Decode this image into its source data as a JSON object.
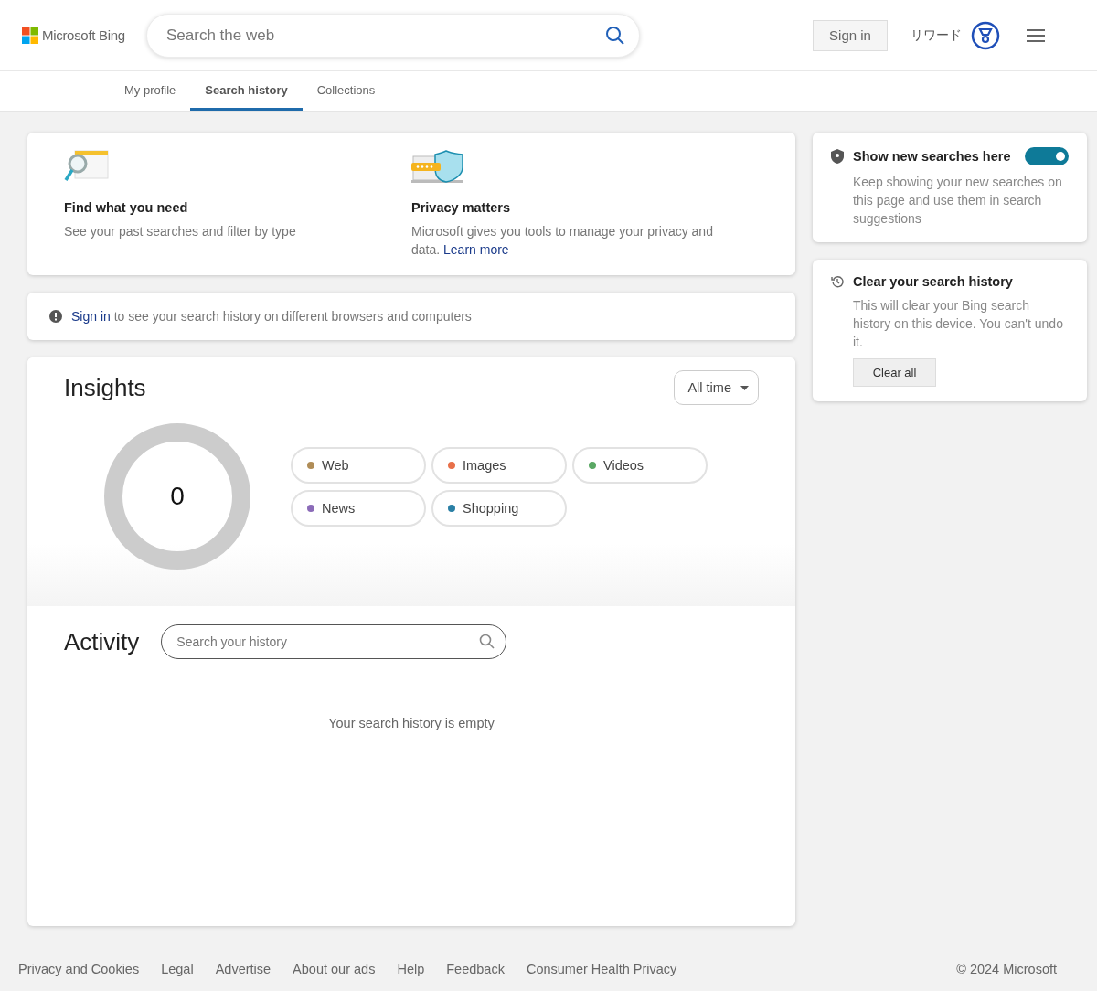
{
  "header": {
    "logo_text": "Microsoft Bing",
    "search": {
      "placeholder": "Search the web"
    },
    "sign_in": "Sign in",
    "rewards": "リワード"
  },
  "tabs": [
    {
      "label": "My profile",
      "selected": false
    },
    {
      "label": "Search history",
      "selected": true
    },
    {
      "label": "Collections",
      "selected": false
    }
  ],
  "features": [
    {
      "kind": "search",
      "title": "Find what you need",
      "text": "See your past searches and filter by type"
    },
    {
      "kind": "privacy",
      "title": "Privacy matters",
      "text": "Microsoft gives you tools to manage your privacy and data.",
      "link": "Learn more"
    }
  ],
  "notice": {
    "link": "Sign in",
    "text": "to see your search history on different browsers and computers"
  },
  "insights": {
    "title": "Insights",
    "period": "All time",
    "total": "0",
    "categories": [
      {
        "label": "Web",
        "color": "#b08d57"
      },
      {
        "label": "Images",
        "color": "#e8704a"
      },
      {
        "label": "Videos",
        "color": "#5aa864"
      },
      {
        "label": "News",
        "color": "#8b6bb8"
      },
      {
        "label": "Shopping",
        "color": "#2a7fa5"
      }
    ]
  },
  "activity": {
    "title": "Activity",
    "search": {
      "placeholder": "Search your history"
    },
    "empty_text": "Your search history is empty"
  },
  "show_searches": {
    "title": "Show new searches here",
    "text": "Keep showing your new searches on this page and use them in search suggestions",
    "on": true
  },
  "clear_history": {
    "title": "Clear your search history",
    "text": "This will clear your Bing search history on this device. You can't undo it.",
    "button": "Clear all"
  },
  "footer": {
    "links": [
      "Privacy and Cookies",
      "Legal",
      "Advertise",
      "About our ads",
      "Help",
      "Feedback",
      "Consumer Health Privacy"
    ],
    "copyright": "© 2024 Microsoft"
  }
}
